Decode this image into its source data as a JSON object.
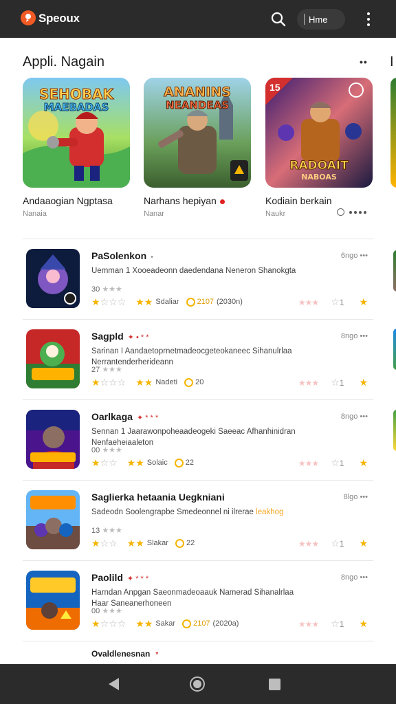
{
  "app": {
    "name": "Speoux",
    "pill_text": "Hme"
  },
  "section": {
    "title": "Appli. Nagain",
    "more": "••",
    "peek_title": "I"
  },
  "featured": [
    {
      "title": "Andaaogian Ngptasa",
      "sub": "Nanaia",
      "art_text_1": "SEHOBAK",
      "art_text_2": "MAEBADAS"
    },
    {
      "title": "Narhans hepiyan",
      "sub": "Nanar",
      "art_text_1": "ANANINS",
      "art_text_2": "NEANDEAS"
    },
    {
      "title": "Kodiain berkain",
      "sub": "Naukr",
      "art_text_1": "RADOAIT",
      "art_text_2": "NABOAS",
      "badge": "15"
    }
  ],
  "list": [
    {
      "title": "PaSolenkon",
      "tag": "•",
      "meta": "6ngo •••",
      "desc": "Uemman 1 Xooeadeonn daedendana Neneron Shanokgta",
      "desc_hl": "",
      "small": "30",
      "label": "Sdaliar",
      "count": "2107",
      "count2": "(2030n)"
    },
    {
      "title": "Sagpld",
      "tag": "✦ • * *",
      "meta": "8ngo •••",
      "desc": "Sarinan I Aandaetoprnetmadeocgeteokaneec Sihanulrlaa Nerrantenderherideann",
      "desc_hl": "",
      "small": "27",
      "label": "Nadeti",
      "count": "20",
      "count2": ""
    },
    {
      "title": "Oarlkaga",
      "tag": "✦ * * *",
      "meta": "8ngo •••",
      "desc": "Sennan 1 Jaarawonpoheaadeogeki Saeeac Afhanhinidran Nenfaeheiaaleton",
      "desc_hl": "",
      "small": "00",
      "label": "Solaic",
      "count": "22",
      "count2": ""
    },
    {
      "title": "Saglierka hetaania Uegkniani",
      "tag": "",
      "meta": "8lgo •••",
      "desc": "Sadeodn Soolengrapbe Smedeonnel ni ilrerae",
      "desc_hl": "leakhog",
      "small": "13",
      "label": "Slakar",
      "count": "22",
      "count2": ""
    },
    {
      "title": "Paolild",
      "tag": "✦ * * *",
      "meta": "8ngo •••",
      "desc": "Harndan Anpgan Saeonmadeoaauk Namerad Sihanalrlaa Haar Saneanerhoneen",
      "desc_hl": "",
      "small": "00",
      "label": "Sakar",
      "count": "2107",
      "count2": "(2020a)"
    }
  ],
  "footer": {
    "title": "Ovaldlenesnan",
    "tag": "*"
  },
  "colors": {
    "bar": "#2b2b2b",
    "accent": "#f15a24",
    "star": "#f5b400"
  }
}
